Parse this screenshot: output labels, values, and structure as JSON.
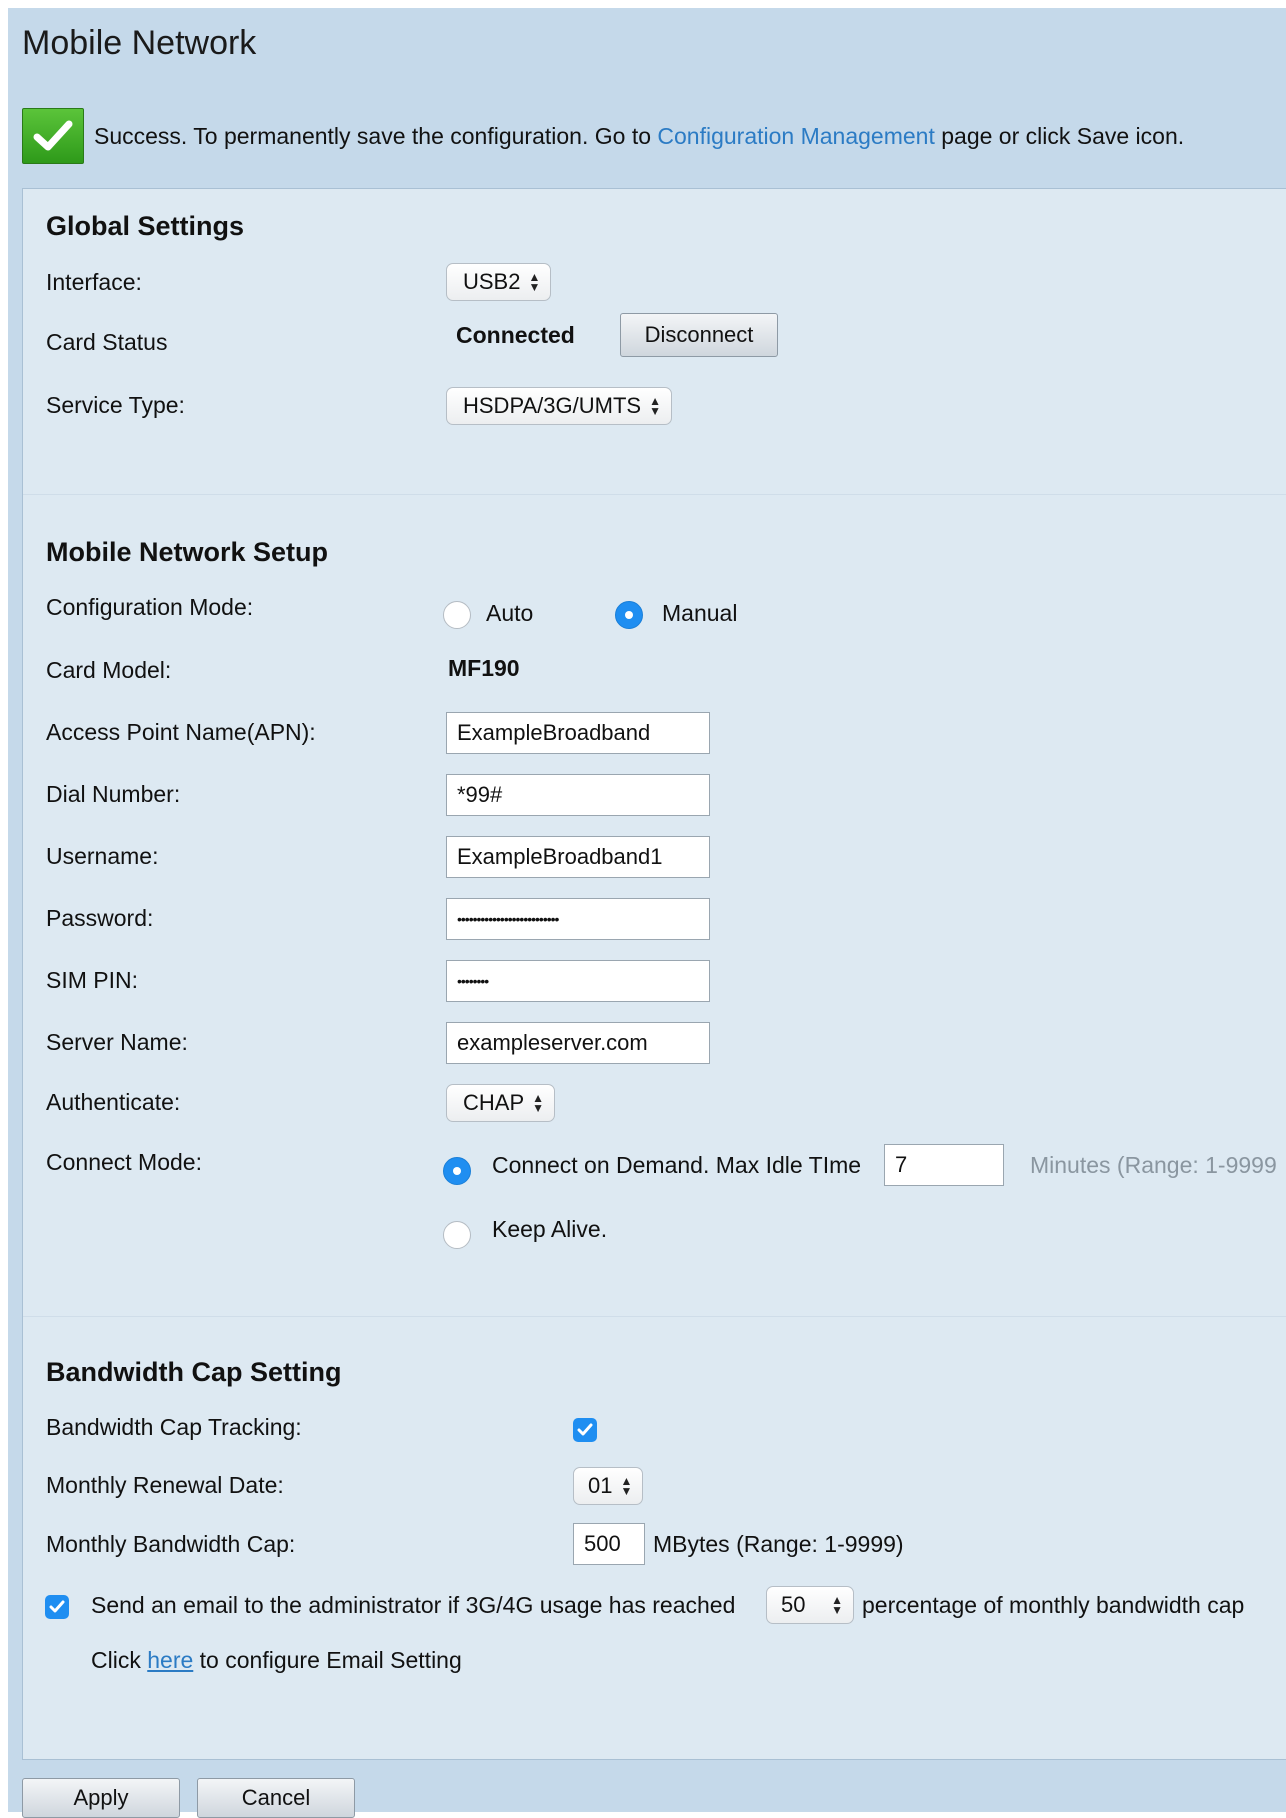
{
  "page_title": "Mobile Network",
  "success": {
    "text_before": "Success. To permanently save the configuration. Go to",
    "link": "Configuration Management",
    "text_after": "page or click Save icon."
  },
  "global_settings": {
    "title": "Global Settings",
    "interface_label": "Interface:",
    "interface_value": "USB2",
    "card_status_label": "Card Status",
    "card_status_value": "Connected",
    "disconnect_button": "Disconnect",
    "service_type_label": "Service Type:",
    "service_type_value": "HSDPA/3G/UMTS"
  },
  "mobile_setup": {
    "title": "Mobile Network Setup",
    "config_mode_label": "Configuration Mode:",
    "config_mode_options": [
      "Auto",
      "Manual"
    ],
    "config_mode_selected": "Manual",
    "card_model_label": "Card Model:",
    "card_model_value": "MF190",
    "apn_label": "Access Point Name(APN):",
    "apn_value": "ExampleBroadband",
    "dial_label": "Dial Number:",
    "dial_value": "*99#",
    "username_label": "Username:",
    "username_value": "ExampleBroadband1",
    "password_label": "Password:",
    "password_value": "••••••••••••••••••••••••••",
    "sim_pin_label": "SIM PIN:",
    "sim_pin_value": "••••••••",
    "server_label": "Server Name:",
    "server_value": "exampleserver.com",
    "auth_label": "Authenticate:",
    "auth_value": "CHAP",
    "connect_mode_label": "Connect Mode:",
    "connect_on_demand": "Connect on Demand. Max Idle TIme",
    "max_idle_value": "7",
    "max_idle_hint": "Minutes (Range: 1-9999",
    "keep_alive": "Keep Alive.",
    "connect_mode_selected": "Connect on Demand"
  },
  "bandwidth": {
    "title": "Bandwidth Cap Setting",
    "tracking_label": "Bandwidth Cap Tracking:",
    "tracking_checked": true,
    "renewal_label": "Monthly Renewal Date:",
    "renewal_value": "01",
    "cap_label": "Monthly Bandwidth Cap:",
    "cap_value": "500",
    "cap_unit": "MBytes (Range: 1-9999)",
    "email_checked": true,
    "email_text_before": "Send an email to the administrator if 3G/4G usage has reached",
    "email_percent": "50",
    "email_text_after": "percentage of monthly bandwidth cap",
    "click_text": "Click",
    "here_link": "here",
    "configure_text": "to configure Email Setting"
  },
  "buttons": {
    "apply": "Apply",
    "cancel": "Cancel"
  },
  "colors": {
    "accent": "#1f8ef1",
    "link": "#2b7bc4",
    "success": "#3aa926",
    "background": "#c5d9ea",
    "panel": "#dde9f2"
  }
}
